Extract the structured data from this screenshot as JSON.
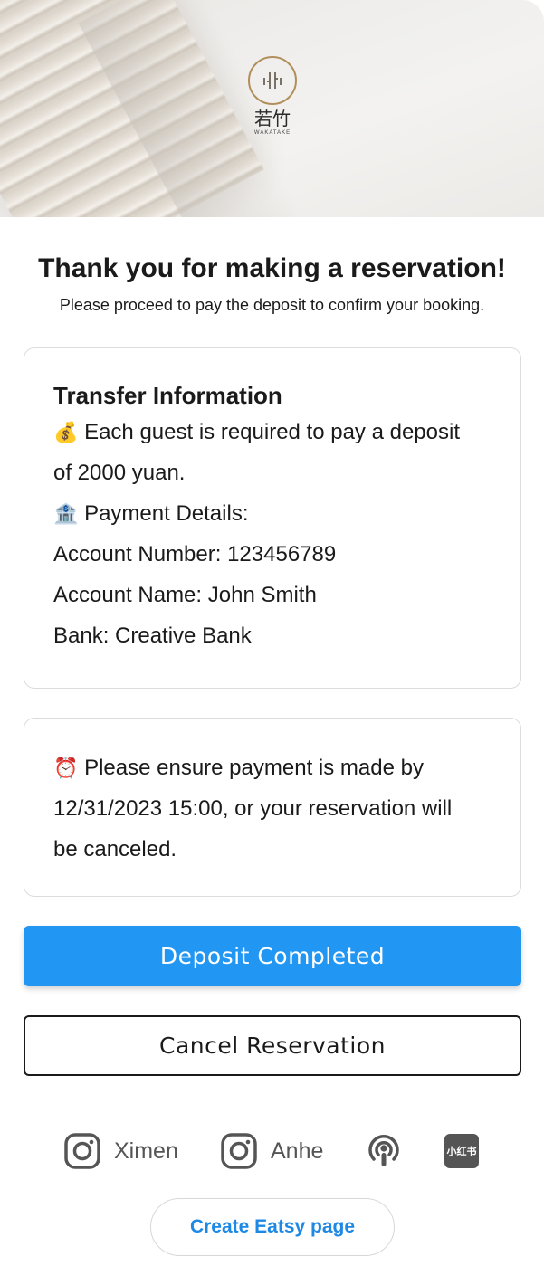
{
  "hero": {
    "logo_cn": "若竹",
    "logo_en": "WAKATAKE"
  },
  "heading": {
    "title": "Thank you for making a reservation!",
    "subtitle": "Please proceed to pay the deposit to confirm your booking."
  },
  "transfer": {
    "title": "Transfer Information",
    "deposit_line1": "Each guest is required to pay a deposit",
    "deposit_line2": "of 2000 yuan.",
    "payment_details": "Payment Details:",
    "account_number": "Account Number: 123456789",
    "account_name": "Account Name: John Smith",
    "bank": "Bank: Creative Bank",
    "deposit_icon": "money-bag-icon",
    "payment_icon": "bank-icon"
  },
  "deadline": {
    "line1": "Please ensure payment is made by",
    "line2": "12/31/2023 15:00, or your reservation will",
    "line3": "be canceled.",
    "icon": "alarm-clock-icon"
  },
  "actions": {
    "deposit_completed": "Deposit Completed",
    "cancel_reservation": "Cancel Reservation"
  },
  "social": {
    "instagram_1": "Ximen",
    "instagram_2": "Anhe",
    "xiaohongshu": "小红书"
  },
  "footer": {
    "eatsy_link": "Create Eatsy page"
  },
  "colors": {
    "primary": "#2196f3",
    "link": "#1e88e5",
    "logo_gold": "#b08f5a"
  }
}
